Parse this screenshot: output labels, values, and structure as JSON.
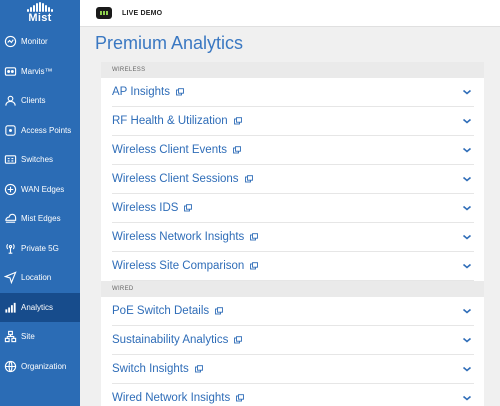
{
  "sidebar": {
    "logo_text": "Mist",
    "items": [
      {
        "label": "Monitor",
        "icon": "monitor-icon"
      },
      {
        "label": "Marvis™",
        "icon": "marvis-icon"
      },
      {
        "label": "Clients",
        "icon": "clients-icon"
      },
      {
        "label": "Access Points",
        "icon": "access-point-icon"
      },
      {
        "label": "Switches",
        "icon": "switch-icon"
      },
      {
        "label": "WAN Edges",
        "icon": "wan-edge-icon"
      },
      {
        "label": "Mist Edges",
        "icon": "mist-edge-icon"
      },
      {
        "label": "Private 5G",
        "icon": "private-5g-icon"
      },
      {
        "label": "Location",
        "icon": "location-icon"
      },
      {
        "label": "Analytics",
        "icon": "analytics-icon"
      },
      {
        "label": "Site",
        "icon": "site-icon"
      },
      {
        "label": "Organization",
        "icon": "organization-icon"
      }
    ],
    "active_item": "Analytics"
  },
  "topbar": {
    "label": "LIVE DEMO"
  },
  "main": {
    "title": "Premium Analytics",
    "sections": [
      {
        "header": "WIRELESS",
        "items": [
          "AP Insights",
          "RF Health & Utilization",
          "Wireless Client Events",
          "Wireless Client Sessions",
          "Wireless IDS",
          "Wireless Network Insights",
          "Wireless Site Comparison"
        ]
      },
      {
        "header": "WIRED",
        "items": [
          "PoE Switch Details",
          "Sustainability Analytics",
          "Switch Insights",
          "Wired Network Insights"
        ]
      }
    ]
  },
  "colors": {
    "sidebar_bg": "#2b6cb5",
    "sidebar_active": "#174c8c",
    "accent": "#2f6db8"
  }
}
